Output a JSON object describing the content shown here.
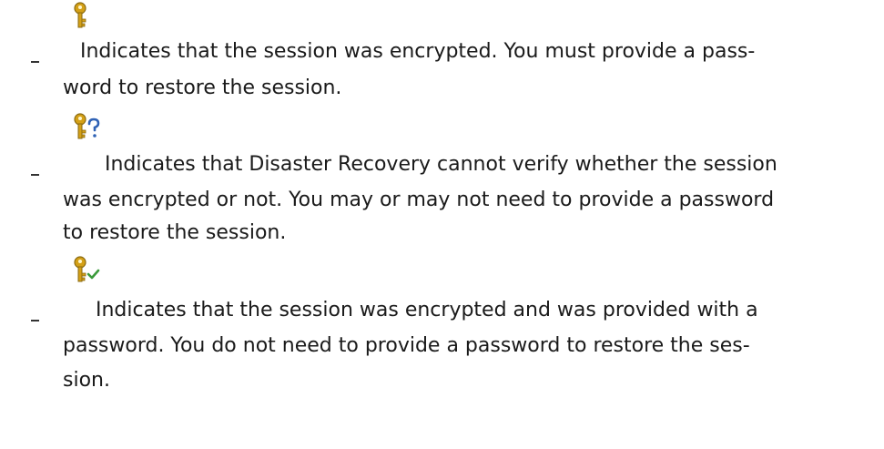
{
  "icons": {
    "encrypted": "key-icon",
    "unknown": "key-question-icon",
    "provided": "key-check-icon"
  },
  "colors": {
    "key_gold": "#d4a017",
    "question_blue": "#2f62b5",
    "check_green": "#3a9a3a"
  },
  "items": [
    {
      "lines": [
        "Indicates that the session was encrypted. You must provide a pass-",
        "word to restore the session."
      ]
    },
    {
      "lines": [
        "Indicates that Disaster Recovery cannot verify whether the session",
        "was encrypted or not. You may or may not need to provide a password",
        "to restore the session."
      ]
    },
    {
      "lines": [
        "Indicates that the session was encrypted and was provided with a",
        "password. You do not need to provide a password to restore the ses-",
        "sion."
      ]
    }
  ]
}
